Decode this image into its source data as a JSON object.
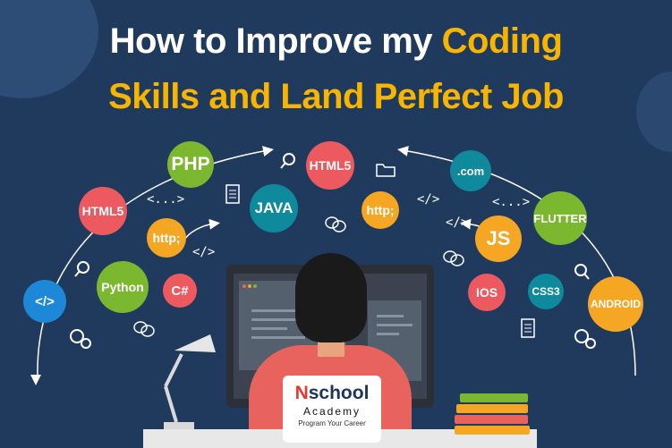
{
  "headline": {
    "line1_white": "How to Improve my",
    "line1_accent": "Coding",
    "line2": "Skills and Land Perfect Job"
  },
  "bubbles": {
    "php": "PHP",
    "html5_top": "HTML5",
    "html5_left": "HTML5",
    "java": "JAVA",
    "http_mid": "http;",
    "http_left": "http;",
    "com": ".com",
    "flutter": "FLUTTER",
    "js": "JS",
    "python": "Python",
    "csharp": "C#",
    "ios": "IOS",
    "css3": "CSS3",
    "android": "ANDROID",
    "code_tag": "</>"
  },
  "symbols": {
    "tag_dots_1": "<...>",
    "tag_dots_2": "<...>",
    "tag_close_1": "</>",
    "tag_close_2": "</>",
    "tag_close_3": "</>"
  },
  "logo": {
    "brand_n": "N",
    "brand_rest": "school",
    "sub": "Academy",
    "tagline": "Program Your Career"
  },
  "colors": {
    "background": "#203a5e",
    "accent": "#f7b500",
    "green": "#7cb82f",
    "red": "#ec5a60",
    "teal": "#0f8a9d",
    "orange": "#f5a623",
    "blue": "#1e88d8"
  }
}
